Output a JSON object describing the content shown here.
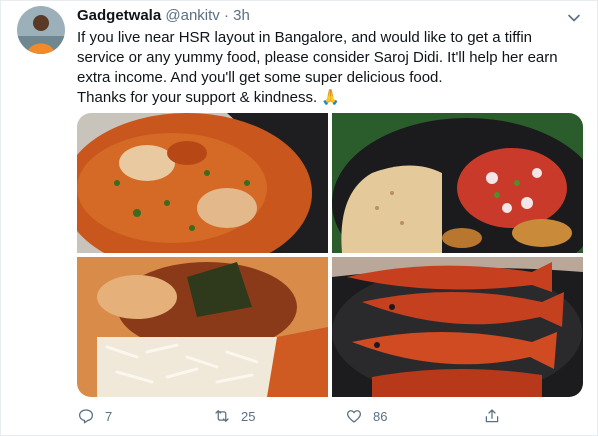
{
  "tweet": {
    "author_name": "Gadgetwala",
    "handle": "@ankitv",
    "separator": " · ",
    "time": "3h",
    "text_lines": [
      "If you live near HSR layout in Bangalore, and would like to get a tiffin",
      "service or any yummy food, please consider Saroj Didi. It'll help her earn",
      "extra income. And you'll get some super delicious food.",
      "Thanks for your support & kindness. 🙏"
    ]
  },
  "media": {
    "images": [
      {
        "icon": "food-photo-curry"
      },
      {
        "icon": "food-photo-roti-salad"
      },
      {
        "icon": "food-photo-fish-curry-rice"
      },
      {
        "icon": "food-photo-fried-fish"
      }
    ]
  },
  "actions": {
    "reply_count": "7",
    "retweet_count": "25",
    "like_count": "86"
  },
  "colors": {
    "secondary_text": "#5b7083",
    "primary_text": "#0f1419"
  }
}
